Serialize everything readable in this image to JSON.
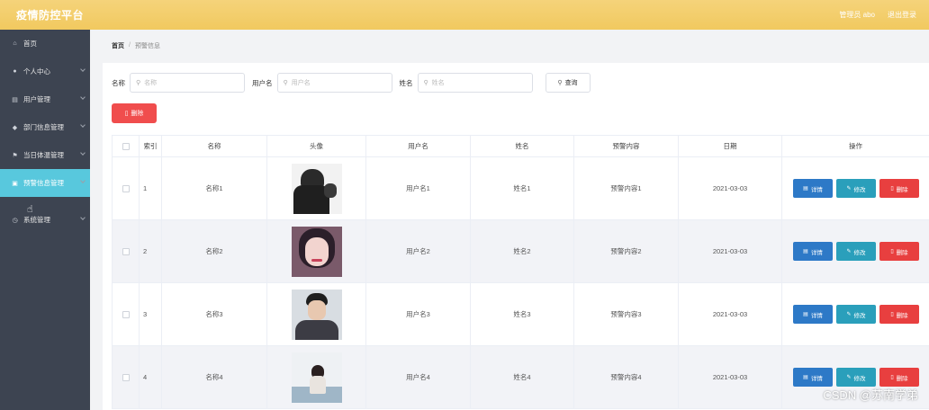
{
  "header": {
    "brand": "疫情防控平台",
    "admin": "管理员 abo",
    "logout": "退出登录"
  },
  "sidebar": {
    "items": [
      {
        "label": "首页",
        "icon": "home-icon",
        "glyph": "⌂"
      },
      {
        "label": "个人中心",
        "icon": "user-icon",
        "glyph": "●"
      },
      {
        "label": "用户管理",
        "icon": "doc-icon",
        "glyph": "▤"
      },
      {
        "label": "部门信息管理",
        "icon": "pin-icon",
        "glyph": "◆"
      },
      {
        "label": "当日体温管理",
        "icon": "flag-icon",
        "glyph": "⚑"
      },
      {
        "label": "预警信息管理",
        "icon": "message-icon",
        "glyph": "▣"
      },
      {
        "label": "系统管理",
        "icon": "clock-icon",
        "glyph": "◷"
      }
    ]
  },
  "breadcrumb": {
    "home": "首页",
    "sep": "/",
    "current": "预警信息"
  },
  "search": {
    "name_label": "名称",
    "name_placeholder": "名称",
    "username_label": "用户名",
    "username_placeholder": "用户名",
    "realname_label": "姓名",
    "realname_placeholder": "姓名",
    "query_button": "查询"
  },
  "toolbar": {
    "delete_button": "删除"
  },
  "table": {
    "headers": [
      "索引",
      "名称",
      "头像",
      "用户名",
      "姓名",
      "预警内容",
      "日期",
      "操作"
    ],
    "rows": [
      {
        "index": "1",
        "name": "名称1",
        "username": "用户名1",
        "realname": "姓名1",
        "content": "预警内容1",
        "date": "2021-03-03"
      },
      {
        "index": "2",
        "name": "名称2",
        "username": "用户名2",
        "realname": "姓名2",
        "content": "预警内容2",
        "date": "2021-03-03"
      },
      {
        "index": "3",
        "name": "名称3",
        "username": "用户名3",
        "realname": "姓名3",
        "content": "预警内容3",
        "date": "2021-03-03"
      },
      {
        "index": "4",
        "name": "名称4",
        "username": "用户名4",
        "realname": "姓名4",
        "content": "预警内容4",
        "date": "2021-03-03"
      }
    ],
    "actions": {
      "detail": "详情",
      "edit": "修改",
      "delete": "删除"
    }
  },
  "watermark": "CSDN @苏南学弟",
  "colors": {
    "header": "#f1c95f",
    "sidebar": "#3d4451",
    "active": "#58c8dd",
    "danger": "#f04d4d",
    "primary": "#2d79c7",
    "info": "#2a9fbb"
  }
}
